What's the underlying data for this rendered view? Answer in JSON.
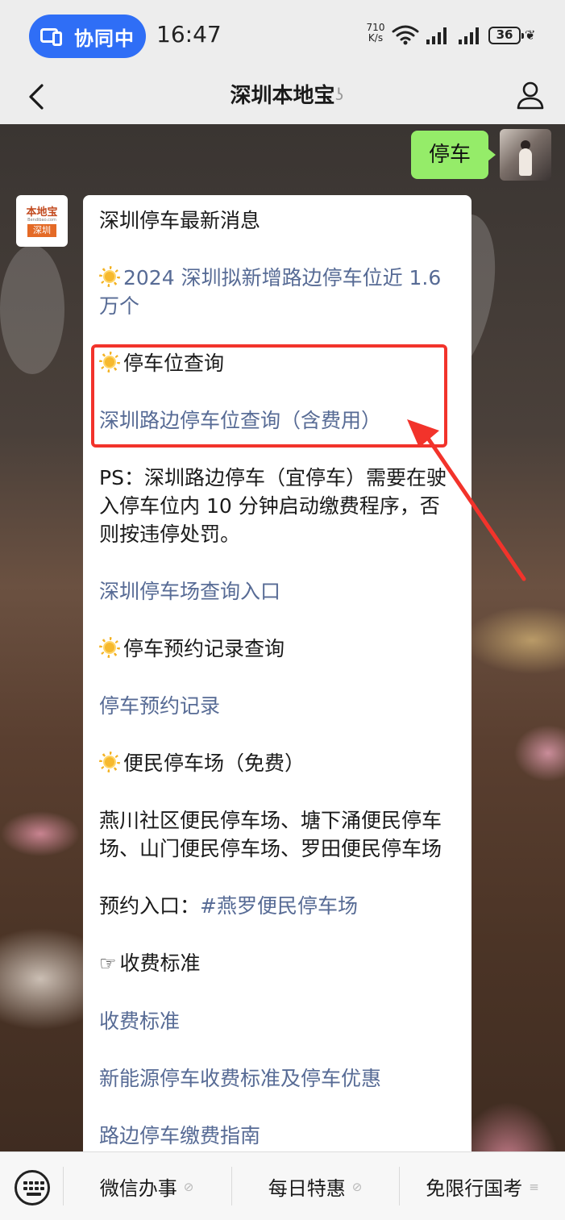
{
  "status_bar": {
    "collab_label": "协同中",
    "time": "16:47",
    "net_speed_value": "710",
    "net_speed_unit": "K/s",
    "battery": "36",
    "icons": [
      "collab-devices-icon",
      "wifi-icon",
      "signal-icon",
      "signal-icon",
      "battery-icon",
      "leaf-icon"
    ]
  },
  "nav": {
    "title": "深圳本地宝",
    "icons": [
      "back-chevron-icon",
      "ear-icon",
      "profile-icon"
    ]
  },
  "chat": {
    "sent_message": "停车",
    "bot_avatar": {
      "brand": "本地宝",
      "domain": "Bendibao.com",
      "city": "深圳"
    },
    "reply": {
      "title": "深圳停车最新消息",
      "news_link": "2024 深圳拟新增路边停车位近 1.6 万个",
      "section_space_query": "停车位查询",
      "space_query_link": "深圳路边停车位查询（含费用）",
      "ps_note": "PS：深圳路边停车（宜停车）需要在驶入停车位内 10 分钟启动缴费程序，否则按违停处罚。",
      "lot_query_link": "深圳停车场查询入口",
      "section_booking": "停车预约记录查询",
      "booking_link": "停车预约记录",
      "section_free": "便民停车场（免费）",
      "free_lots": "燕川社区便民停车场、塘下涌便民停车场、山门便民停车场、罗田便民停车场",
      "booking_entry_label": "预约入口：",
      "booking_entry_link": "#燕罗便民停车场",
      "section_fees": "收费标准",
      "fees_link": "收费标准",
      "ev_link": "新能源停车收费标准及停车优惠",
      "cut_off_link": "路边停车缴费指南"
    },
    "annotation_color": "#f2332b"
  },
  "bottom_menu": {
    "items": [
      {
        "label": "微信办事",
        "icon": "link-icon"
      },
      {
        "label": "每日特惠",
        "icon": "link-icon"
      },
      {
        "label": "免限行国考",
        "icon": "menu-lines-icon"
      }
    ],
    "keyboard_icon": "keyboard-icon"
  },
  "colors": {
    "link": "#576b95",
    "sent_bubble": "#95ec69",
    "collab_pill": "#2f6ef6"
  }
}
